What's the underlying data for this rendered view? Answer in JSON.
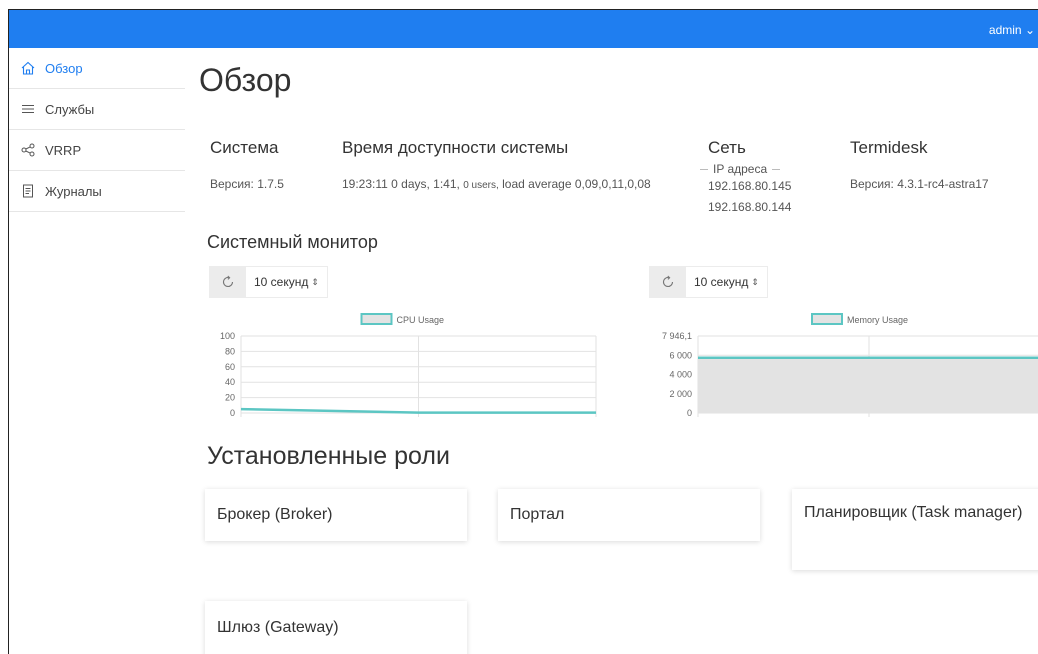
{
  "topbar": {
    "user": "admin"
  },
  "sidebar": {
    "items": [
      {
        "label": "Обзор",
        "icon": "home-icon",
        "active": true
      },
      {
        "label": "Службы",
        "icon": "list-icon",
        "active": false
      },
      {
        "label": "VRRP",
        "icon": "share-icon",
        "active": false
      },
      {
        "label": "Журналы",
        "icon": "document-icon",
        "active": false
      }
    ]
  },
  "page": {
    "title": "Обзор"
  },
  "info": {
    "system": {
      "title": "Система",
      "version": "Версия: 1.7.5"
    },
    "uptime": {
      "title": "Время доступности системы",
      "value": "19:23:11 0 days, 1:41,",
      "users": "0 users,",
      "load": "load average 0,09,0,11,0,08"
    },
    "network": {
      "title": "Сеть",
      "ip_label": "IP адреса",
      "ips": [
        "192.168.80.145",
        "192.168.80.144"
      ]
    },
    "termidesk": {
      "title": "Termidesk",
      "version": "Версия: 4.3.1-rc4-astra17"
    }
  },
  "monitor": {
    "title": "Системный монитор",
    "cpu_interval": "10 секунд",
    "mem_interval": "10 секунд"
  },
  "chart_data": [
    {
      "type": "line",
      "title": "",
      "series": [
        {
          "name": "CPU Usage",
          "values": [
            5,
            0.5,
            0.5
          ]
        }
      ],
      "x": [
        0,
        1,
        2
      ],
      "yticks": [
        "100",
        "80",
        "60",
        "40",
        "20",
        "0"
      ],
      "ylim": [
        0,
        100
      ],
      "grid": true,
      "legend": "top",
      "color": "#5cc6c3"
    },
    {
      "type": "area",
      "title": "",
      "series": [
        {
          "name": "Memory Usage",
          "values": [
            5700,
            5700,
            5700
          ]
        }
      ],
      "x": [
        0,
        1,
        2
      ],
      "yticks": [
        "7 946,1",
        "6 000",
        "4 000",
        "2 000",
        "0"
      ],
      "ylim": [
        0,
        7946.1
      ],
      "grid": true,
      "legend": "top",
      "color": "#5cc6c3",
      "fill": "#e3e3e3"
    }
  ],
  "roles": {
    "title": "Установленные роли",
    "items": [
      {
        "label": "Брокер (Broker)"
      },
      {
        "label": "Портал"
      },
      {
        "label": "Планировщик (Task manager)"
      },
      {
        "label": "Шлюз (Gateway)"
      }
    ]
  }
}
